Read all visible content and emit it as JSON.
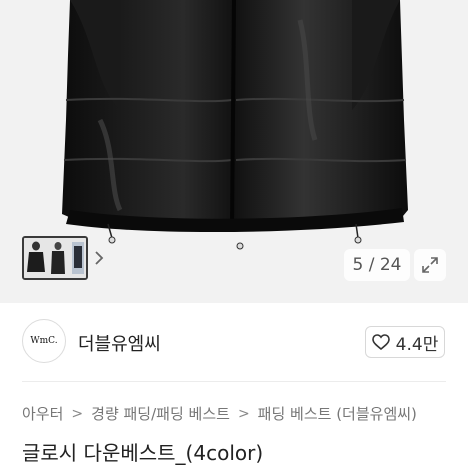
{
  "gallery": {
    "counter": "5 / 24",
    "expand_icon": "expand-icon",
    "next_icon": "chevron-right-icon"
  },
  "brand": {
    "logo_text": "WmC.",
    "name": "더블유엠씨"
  },
  "like": {
    "icon": "heart-outline-icon",
    "count": "4.4만"
  },
  "breadcrumb": {
    "items": [
      "아우터",
      "경량 패딩/패딩 베스트",
      "패딩 베스트 (더블유엠씨)"
    ],
    "separator": ">"
  },
  "product": {
    "title": "글로시 다운베스트_(4color)"
  },
  "colors": {
    "background": "#ffffff",
    "image_bg": "#f2f2f2",
    "garment": "#111111"
  }
}
